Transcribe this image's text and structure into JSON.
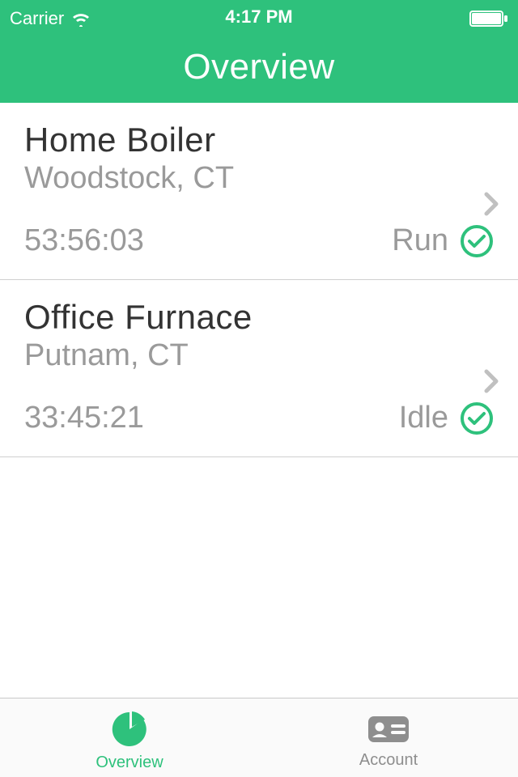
{
  "status_bar": {
    "carrier": "Carrier",
    "time": "4:17 PM"
  },
  "header": {
    "title": "Overview"
  },
  "devices": [
    {
      "name": "Home Boiler",
      "location": "Woodstock, CT",
      "runtime": "53:56:03",
      "state": "Run"
    },
    {
      "name": "Office Furnace",
      "location": "Putnam, CT",
      "runtime": "33:45:21",
      "state": "Idle"
    }
  ],
  "tabs": {
    "overview": "Overview",
    "account": "Account"
  },
  "colors": {
    "accent": "#2ec17c",
    "muted": "#9a9a9a"
  }
}
